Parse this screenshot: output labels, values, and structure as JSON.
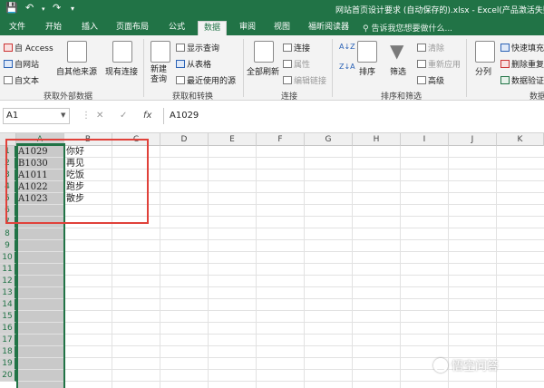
{
  "window": {
    "title": "网站首页设计要求 (自动保存的).xlsx - Excel(产品激活失败"
  },
  "ribbon_tabs": [
    "文件",
    "开始",
    "插入",
    "页面布局",
    "公式",
    "数据",
    "审阅",
    "视图",
    "福昕阅读器"
  ],
  "active_tab": "数据",
  "tell_me": "告诉我您想要做什么...",
  "ribbon": {
    "get_external": {
      "items": [
        "自 Access",
        "自网站",
        "自文本"
      ],
      "other_sources": "自其他来源",
      "existing": "现有连接",
      "label": "获取外部数据"
    },
    "get_transform": {
      "new_query": "新建\n查询",
      "new_query_line1": "新建",
      "new_query_line2": "查询",
      "items": [
        "显示查询",
        "从表格",
        "最近使用的源"
      ],
      "label": "获取和转换"
    },
    "connections": {
      "refresh_all": "全部刷新",
      "items": [
        "连接",
        "属性",
        "编辑链接"
      ],
      "label": "连接"
    },
    "sort_filter": {
      "sort": "排序",
      "filter": "筛选",
      "items": [
        "清除",
        "重新应用",
        "高级"
      ],
      "label": "排序和筛选"
    },
    "data_tools": {
      "split": "分列",
      "items": [
        "快速填充",
        "删除重复",
        "数据验证"
      ],
      "label": "数据"
    }
  },
  "formula_bar": {
    "name_box": "A1",
    "cancel": "✕",
    "enter": "✓",
    "fx": "fx",
    "value": "A1029"
  },
  "columns": [
    "A",
    "B",
    "C",
    "D",
    "E",
    "F",
    "G",
    "H",
    "I",
    "J",
    "K"
  ],
  "rows": [
    "1",
    "2",
    "3",
    "4",
    "5",
    "6",
    "7",
    "8",
    "9",
    "10",
    "11",
    "12",
    "13",
    "14",
    "15",
    "16",
    "17",
    "18",
    "19",
    "20"
  ],
  "cells": [
    {
      "a": "A1029",
      "b": "你好"
    },
    {
      "a": "B1030",
      "b": "再见"
    },
    {
      "a": "A1011",
      "b": "吃饭"
    },
    {
      "a": "A1022",
      "b": "跑步"
    },
    {
      "a": "A1023",
      "b": "散步"
    }
  ],
  "watermark": "悟空问答",
  "colors": {
    "excel_green": "#217346",
    "highlight_box": "#e0413a",
    "selected_column": "#c9c9c9"
  }
}
